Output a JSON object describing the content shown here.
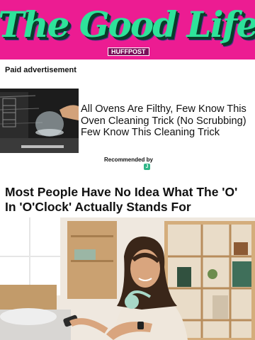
{
  "banner": {
    "title": "The Good Life",
    "brand": "HUFFPOST",
    "colors": {
      "background": "#ec1c92",
      "title": "#2ee39a"
    }
  },
  "ad": {
    "label": "Paid advertisement",
    "headline": "All Ovens Are Filthy, Few Know This Oven Cleaning Trick (No Scrubbing) Few Know This Cleaning Trick",
    "image_icon": "oven-photo",
    "recommended_label": "Recommended by",
    "recommended_icon": "recommender-logo-icon"
  },
  "article": {
    "title": "Most People Have No Idea What The 'O' In 'O'Clock' Actually Stands For",
    "image_icon": "woman-checking-watch-photo"
  }
}
